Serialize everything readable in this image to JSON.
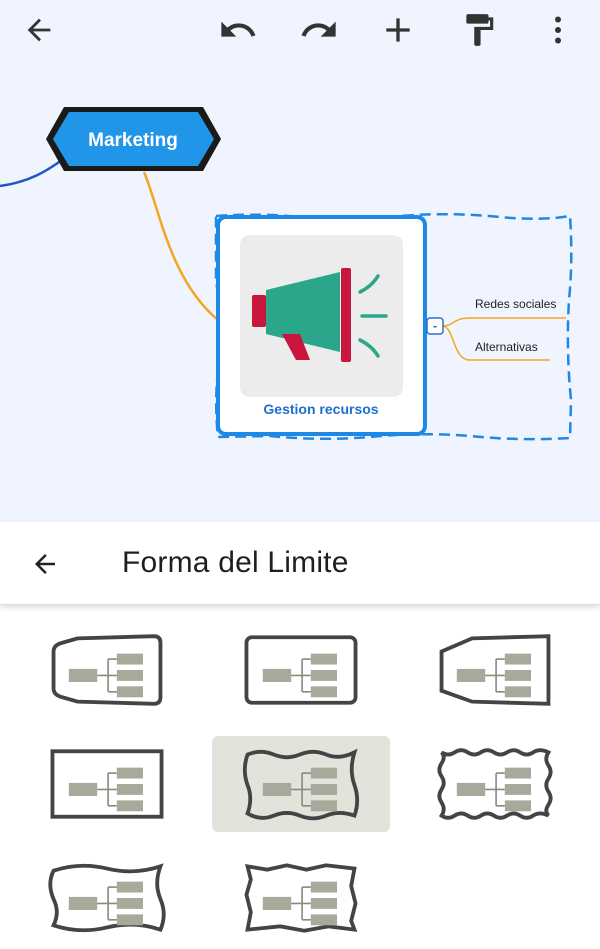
{
  "toolbar": {
    "back_icon": "arrow-left-icon",
    "undo_icon": "undo-icon",
    "redo_icon": "redo-icon",
    "add_icon": "plus-icon",
    "style_icon": "paint-roller-icon",
    "more_icon": "more-vertical-icon"
  },
  "mindmap": {
    "central_node": {
      "label": "Marketing",
      "color": "#2196e8"
    },
    "resource_node": {
      "label": "Gestion recursos",
      "image": "megaphone-icon",
      "border_color": "#1e88e5"
    },
    "collapse_label": "-",
    "subtopics": [
      {
        "label": "Redes sociales"
      },
      {
        "label": "Alternativas"
      }
    ],
    "boundary_color": "#1e88e5",
    "branch_color": "#f4a623"
  },
  "panel": {
    "back_icon": "arrow-left-icon",
    "title": "Forma del Limite"
  },
  "shapes": {
    "options": [
      {
        "name": "rounded-tab"
      },
      {
        "name": "rounded-rect"
      },
      {
        "name": "trapezoid-left"
      },
      {
        "name": "rectangle"
      },
      {
        "name": "wavy",
        "selected": true
      },
      {
        "name": "scalloped"
      },
      {
        "name": "wavy-ribbon"
      },
      {
        "name": "zigzag"
      }
    ]
  }
}
